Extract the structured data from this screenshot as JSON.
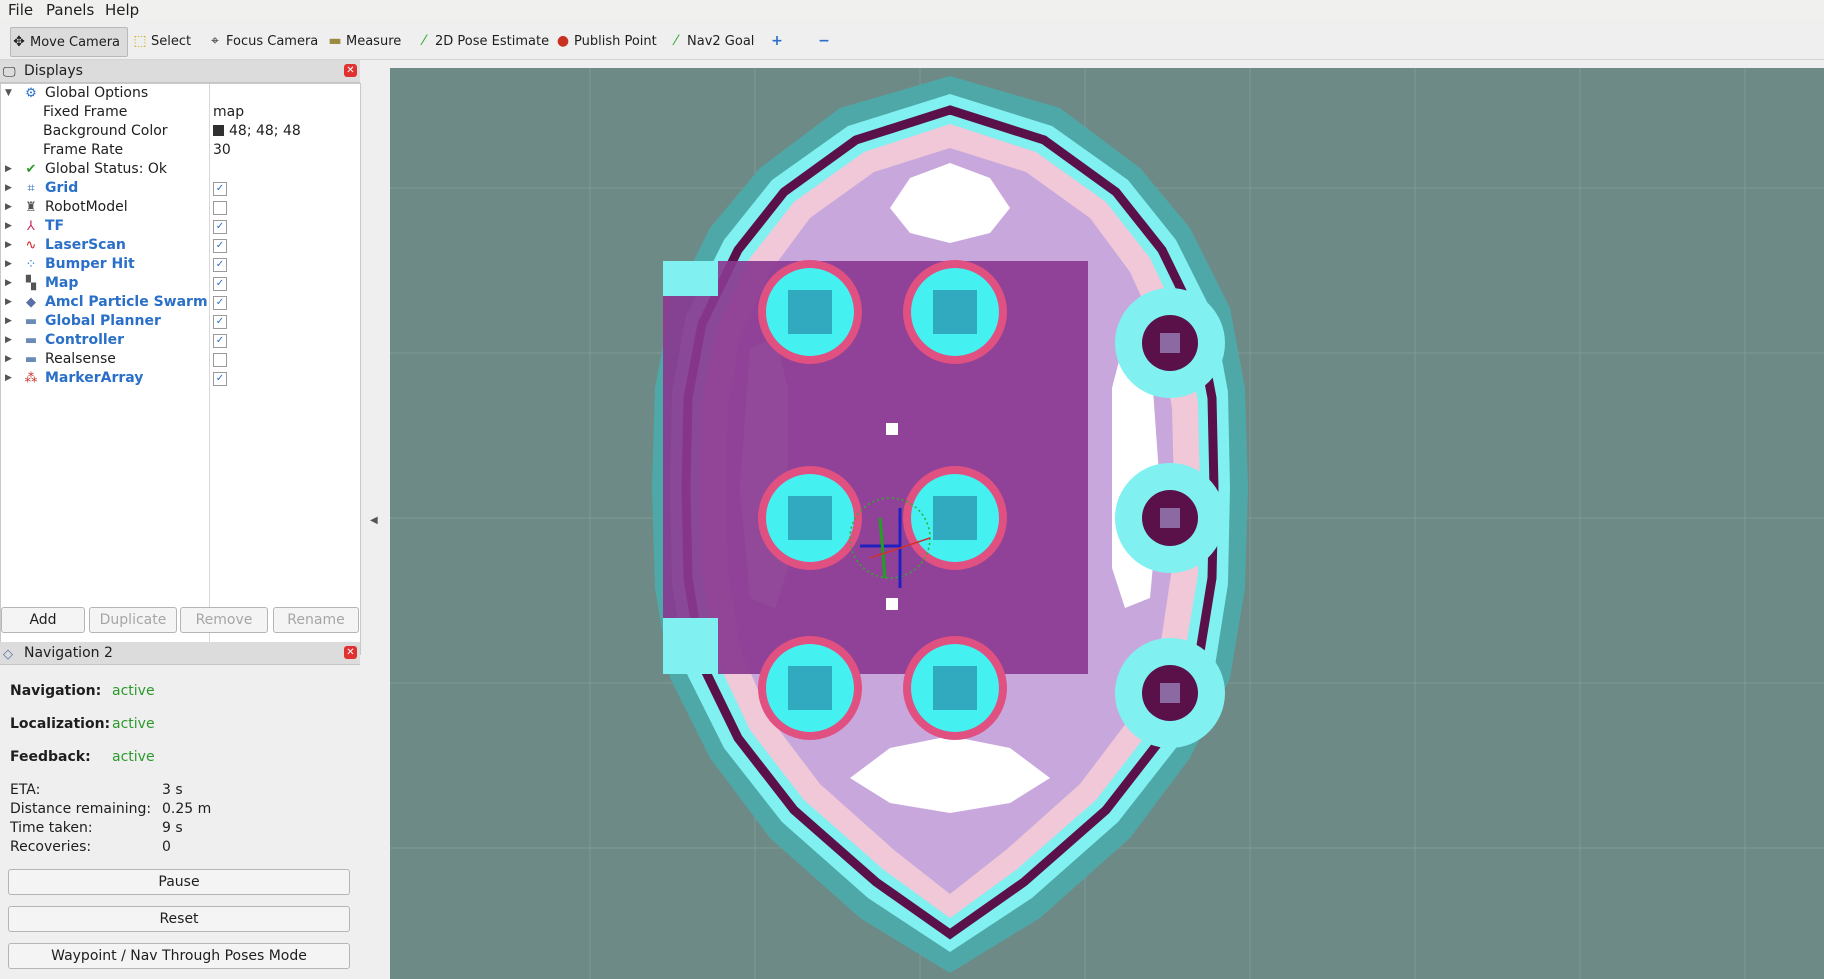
{
  "menu": [
    "File",
    "Panels",
    "Help"
  ],
  "toolbar": {
    "tools": [
      "Move Camera",
      "Select",
      "Focus Camera",
      "Measure",
      "2D Pose Estimate",
      "Publish Point",
      "Nav2 Goal"
    ],
    "icons": [
      "move-camera-icon",
      "select-icon",
      "focus-camera-icon",
      "measure-icon",
      "pose-estimate-icon",
      "publish-point-icon",
      "nav2-goal-icon",
      "add-tool-icon",
      "remove-tool-icon"
    ]
  },
  "displays": {
    "title": "Displays",
    "global_options": "Global Options",
    "fixed_frame_label": "Fixed Frame",
    "fixed_frame_value": "map",
    "background_color_label": "Background Color",
    "background_color_value": "48; 48; 48",
    "frame_rate_label": "Frame Rate",
    "frame_rate_value": "30",
    "global_status": "Global Status: Ok",
    "items": [
      {
        "label": "Grid",
        "checked": true
      },
      {
        "label": "RobotModel",
        "checked": false
      },
      {
        "label": "TF",
        "checked": true
      },
      {
        "label": "LaserScan",
        "checked": true
      },
      {
        "label": "Bumper Hit",
        "checked": true
      },
      {
        "label": "Map",
        "checked": true
      },
      {
        "label": "Amcl Particle Swarm",
        "checked": true
      },
      {
        "label": "Global Planner",
        "checked": true
      },
      {
        "label": "Controller",
        "checked": true
      },
      {
        "label": "Realsense",
        "checked": false
      },
      {
        "label": "MarkerArray",
        "checked": true
      }
    ],
    "buttons": {
      "add": "Add",
      "duplicate": "Duplicate",
      "remove": "Remove",
      "rename": "Rename"
    }
  },
  "nav2": {
    "title": "Navigation 2",
    "navigation_label": "Navigation:",
    "navigation_value": "active",
    "localization_label": "Localization:",
    "localization_value": "active",
    "feedback_label": "Feedback:",
    "feedback_value": "active",
    "eta_label": "ETA:",
    "eta_value": "3 s",
    "distance_label": "Distance remaining:",
    "distance_value": "0.25 m",
    "time_label": "Time taken:",
    "time_value": "9 s",
    "recoveries_label": "Recoveries:",
    "recoveries_value": "0",
    "pause": "Pause",
    "reset": "Reset",
    "waypoint_mode": "Waypoint / Nav Through Poses Mode"
  },
  "colors": {
    "map_background": "#6e8a86",
    "cost_lethal": "#5a1048",
    "cost_high": "#8a3a90",
    "cost_mid": "#e8a0b8",
    "cost_low": "#b8a0d8",
    "free": "#ffffff",
    "inflation": "#80f0f0",
    "outer": "#4fa8a8",
    "obstacle": "#31c6d8"
  }
}
